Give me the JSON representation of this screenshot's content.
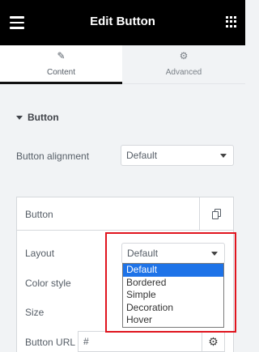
{
  "header": {
    "title": "Edit Button",
    "menu_icon": "hamburger-icon",
    "apps_icon": "grid-icon"
  },
  "tabs": [
    {
      "label": "Content",
      "icon": "pencil-icon",
      "active": true
    },
    {
      "label": "Advanced",
      "icon": "gear-icon",
      "active": false
    }
  ],
  "section": {
    "title": "Button"
  },
  "button_alignment": {
    "label": "Button alignment",
    "value": "Default"
  },
  "card": {
    "title": "Button",
    "layout": {
      "label": "Layout",
      "value": "Default"
    },
    "color_style": {
      "label": "Color style"
    },
    "size": {
      "label": "Size"
    },
    "button_url": {
      "label": "Button URL",
      "value": "#"
    },
    "layout_options": [
      "Default",
      "Bordered",
      "Simple",
      "Decoration",
      "Hover"
    ],
    "selected_option": "Default"
  },
  "colors": {
    "highlight": "#e0141e",
    "selection": "#1e73e8",
    "topbar": "#000000"
  }
}
